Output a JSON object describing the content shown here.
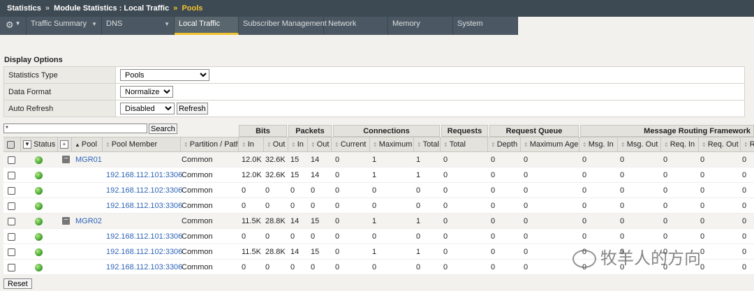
{
  "breadcrumb": {
    "part1": "Statistics",
    "sep1": "»",
    "part2": "Module Statistics : Local Traffic",
    "sep2": "»",
    "current": "Pools"
  },
  "nav": {
    "gear_icon": "gear-icon",
    "tabs": [
      "Traffic Summary",
      "DNS",
      "Local Traffic",
      "Subscriber Management",
      "Network",
      "Memory",
      "System"
    ],
    "active": "Local Traffic"
  },
  "display_options": {
    "title": "Display Options",
    "statistics_type": {
      "label": "Statistics Type",
      "value": "Pools"
    },
    "data_format": {
      "label": "Data Format",
      "value": "Normalized"
    },
    "auto_refresh": {
      "label": "Auto Refresh",
      "value": "Disabled",
      "button": "Refresh"
    }
  },
  "search": {
    "value": "*",
    "button": "Search"
  },
  "groups": [
    "Bits",
    "Packets",
    "Connections",
    "Requests",
    "Request Queue",
    "Message Routing Framework"
  ],
  "columns": [
    "Status",
    "Pool",
    "Pool Member",
    "Partition / Path",
    "In",
    "Out",
    "In",
    "Out",
    "Current",
    "Maximum",
    "Total",
    "Total",
    "Depth",
    "Maximum Age",
    "Msg. In",
    "Msg. Out",
    "Req. In",
    "Req. Out",
    "R"
  ],
  "rows": [
    {
      "pool": "MGR01",
      "member": "",
      "partition": "Common",
      "bits_in": "12.0K",
      "bits_out": "32.6K",
      "pkt_in": "15",
      "pkt_out": "14",
      "cur": "0",
      "max": "1",
      "total": "1",
      "req_total": "0",
      "depth": "0",
      "max_age": "0",
      "msg_in": "0",
      "msg_out": "0",
      "req_in": "0",
      "req_out": "0",
      "r": "0"
    },
    {
      "pool": "",
      "member": "192.168.112.101:3306",
      "partition": "Common",
      "bits_in": "12.0K",
      "bits_out": "32.6K",
      "pkt_in": "15",
      "pkt_out": "14",
      "cur": "0",
      "max": "1",
      "total": "1",
      "req_total": "0",
      "depth": "0",
      "max_age": "0",
      "msg_in": "0",
      "msg_out": "0",
      "req_in": "0",
      "req_out": "0",
      "r": "0"
    },
    {
      "pool": "",
      "member": "192.168.112.102:3306",
      "partition": "Common",
      "bits_in": "0",
      "bits_out": "0",
      "pkt_in": "0",
      "pkt_out": "0",
      "cur": "0",
      "max": "0",
      "total": "0",
      "req_total": "0",
      "depth": "0",
      "max_age": "0",
      "msg_in": "0",
      "msg_out": "0",
      "req_in": "0",
      "req_out": "0",
      "r": "0"
    },
    {
      "pool": "",
      "member": "192.168.112.103:3306",
      "partition": "Common",
      "bits_in": "0",
      "bits_out": "0",
      "pkt_in": "0",
      "pkt_out": "0",
      "cur": "0",
      "max": "0",
      "total": "0",
      "req_total": "0",
      "depth": "0",
      "max_age": "0",
      "msg_in": "0",
      "msg_out": "0",
      "req_in": "0",
      "req_out": "0",
      "r": "0"
    },
    {
      "pool": "MGR02",
      "member": "",
      "partition": "Common",
      "bits_in": "11.5K",
      "bits_out": "28.8K",
      "pkt_in": "14",
      "pkt_out": "15",
      "cur": "0",
      "max": "1",
      "total": "1",
      "req_total": "0",
      "depth": "0",
      "max_age": "0",
      "msg_in": "0",
      "msg_out": "0",
      "req_in": "0",
      "req_out": "0",
      "r": "0"
    },
    {
      "pool": "",
      "member": "192.168.112.101:3306",
      "partition": "Common",
      "bits_in": "0",
      "bits_out": "0",
      "pkt_in": "0",
      "pkt_out": "0",
      "cur": "0",
      "max": "0",
      "total": "0",
      "req_total": "0",
      "depth": "0",
      "max_age": "0",
      "msg_in": "0",
      "msg_out": "0",
      "req_in": "0",
      "req_out": "0",
      "r": "0"
    },
    {
      "pool": "",
      "member": "192.168.112.102:3306",
      "partition": "Common",
      "bits_in": "11.5K",
      "bits_out": "28.8K",
      "pkt_in": "14",
      "pkt_out": "15",
      "cur": "0",
      "max": "1",
      "total": "1",
      "req_total": "0",
      "depth": "0",
      "max_age": "0",
      "msg_in": "0",
      "msg_out": "0",
      "req_in": "0",
      "req_out": "0",
      "r": "0"
    },
    {
      "pool": "",
      "member": "192.168.112.103:3306",
      "partition": "Common",
      "bits_in": "0",
      "bits_out": "0",
      "pkt_in": "0",
      "pkt_out": "0",
      "cur": "0",
      "max": "0",
      "total": "0",
      "req_total": "0",
      "depth": "0",
      "max_age": "0",
      "msg_in": "0",
      "msg_out": "0",
      "req_in": "0",
      "req_out": "0",
      "r": "0"
    }
  ],
  "reset_button": "Reset",
  "watermark": "牧羊人的方向",
  "colors": {
    "accent": "#f0c330",
    "link": "#2e63b6",
    "status_green": "#3da12a"
  }
}
